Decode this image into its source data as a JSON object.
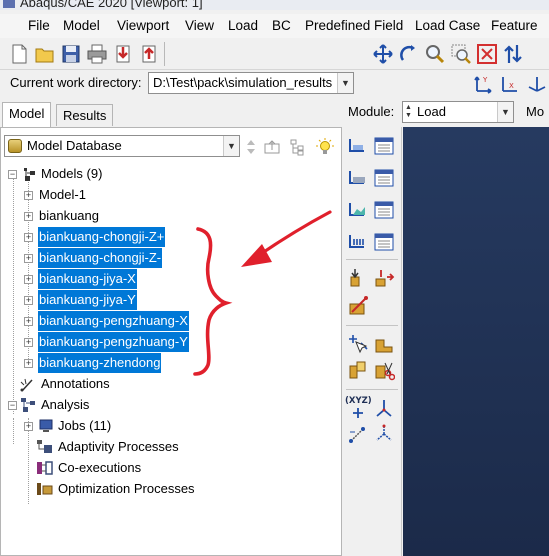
{
  "window": {
    "title": "Abaqus/CAE 2020 [Viewport: 1]"
  },
  "menu": [
    {
      "label": "File"
    },
    {
      "label": "Model"
    },
    {
      "label": "Viewport"
    },
    {
      "label": "View"
    },
    {
      "label": "Load"
    },
    {
      "label": "BC"
    },
    {
      "label": "Predefined Field"
    },
    {
      "label": "Load Case"
    },
    {
      "label": "Feature"
    }
  ],
  "cwd": {
    "label": "Current work directory:",
    "value": "D:\\Test\\pack\\simulation_results"
  },
  "tabs": {
    "model": "Model",
    "results": "Results"
  },
  "database": {
    "label": "Model Database"
  },
  "module": {
    "label": "Module:",
    "value": "Load",
    "next_label": "Mo"
  },
  "tree": {
    "models_label": "Models (9)",
    "models": [
      {
        "name": "Model-1",
        "selected": false
      },
      {
        "name": "biankuang",
        "selected": false
      },
      {
        "name": "biankuang-chongji-Z+",
        "selected": true
      },
      {
        "name": "biankuang-chongji-Z-",
        "selected": true
      },
      {
        "name": "biankuang-jiya-X",
        "selected": true
      },
      {
        "name": "biankuang-jiya-Y",
        "selected": true
      },
      {
        "name": "biankuang-pengzhuang-X",
        "selected": true
      },
      {
        "name": "biankuang-pengzhuang-Y",
        "selected": true
      },
      {
        "name": "biankuang-zhendong",
        "selected": true
      }
    ],
    "annotations": "Annotations",
    "analysis": "Analysis",
    "jobs": "Jobs (11)",
    "adaptivity": "Adaptivity Processes",
    "coexec": "Co-executions",
    "optimization": "Optimization Processes"
  },
  "colors": {
    "selection": "#0078d7",
    "annotation": "#e0202c",
    "viewport": "#1f3052"
  },
  "icons": [
    "new-icon",
    "open-icon",
    "save-icon",
    "print-icon",
    "import-icon",
    "export-icon",
    "pan-icon",
    "rotate-icon",
    "zoom-icon",
    "zoom-box-icon",
    "fit-icon",
    "swap-icon",
    "csys-icon"
  ],
  "toolbox": {
    "xyz_label": "(XYZ)"
  }
}
